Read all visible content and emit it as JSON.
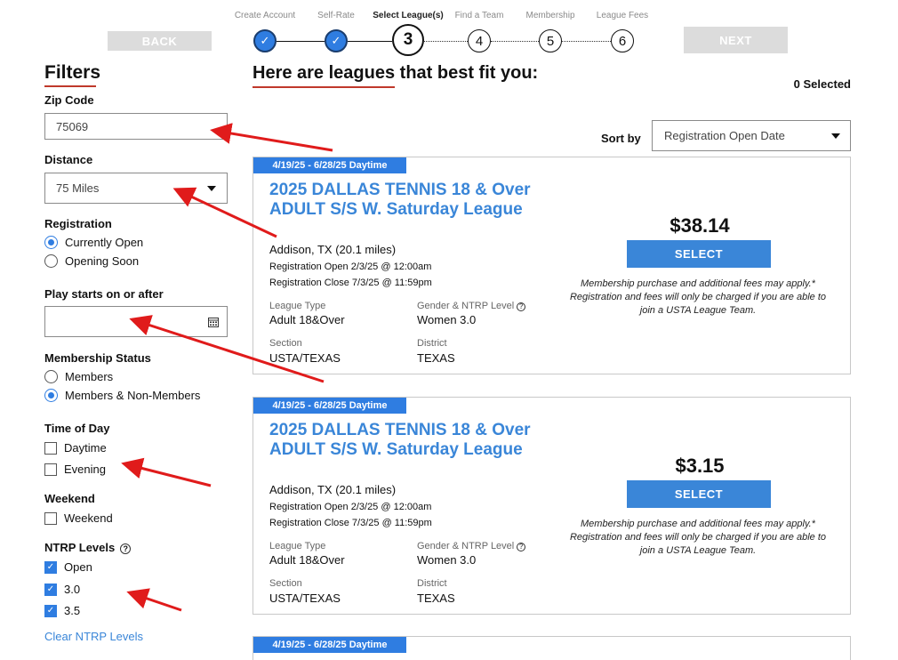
{
  "stepper": {
    "steps": [
      {
        "label": "Create Account",
        "number": "",
        "state": "done"
      },
      {
        "label": "Self-Rate",
        "number": "",
        "state": "done"
      },
      {
        "label": "Select League(s)",
        "number": "3",
        "state": "current"
      },
      {
        "label": "Find a Team",
        "number": "4",
        "state": "todo"
      },
      {
        "label": "Membership",
        "number": "5",
        "state": "todo"
      },
      {
        "label": "League Fees",
        "number": "6",
        "state": "todo"
      }
    ],
    "check_glyph": "✓",
    "back_label": "BACK",
    "next_label": "NEXT"
  },
  "filters": {
    "title": "Filters",
    "zip": {
      "label": "Zip Code",
      "value": "75069"
    },
    "distance": {
      "label": "Distance",
      "value": "75 Miles"
    },
    "registration": {
      "label": "Registration",
      "options": [
        {
          "label": "Currently Open",
          "selected": true
        },
        {
          "label": "Opening Soon",
          "selected": false
        }
      ]
    },
    "play_starts": {
      "label": "Play starts on or after",
      "value": ""
    },
    "membership": {
      "label": "Membership Status",
      "options": [
        {
          "label": "Members",
          "selected": false
        },
        {
          "label": "Members & Non-Members",
          "selected": true
        }
      ]
    },
    "time_of_day": {
      "label": "Time of Day",
      "options": [
        {
          "label": "Daytime",
          "checked": false
        },
        {
          "label": "Evening",
          "checked": false
        }
      ]
    },
    "weekend": {
      "label": "Weekend",
      "options": [
        {
          "label": "Weekend",
          "checked": false
        }
      ]
    },
    "ntrp": {
      "label": "NTRP Levels",
      "help": "?",
      "options": [
        {
          "label": "Open",
          "checked": true
        },
        {
          "label": "3.0",
          "checked": true
        },
        {
          "label": "3.5",
          "checked": true
        }
      ]
    },
    "clear_label": "Clear NTRP Levels"
  },
  "main": {
    "title": "Here are leagues that best fit you:",
    "selected_count": "0 Selected",
    "sort_label": "Sort by",
    "sort_value": "Registration Open Date"
  },
  "cards": [
    {
      "tag": "4/19/25 - 6/28/25 Daytime",
      "title": "2025 DALLAS TENNIS 18 & Over ADULT S/S W. Saturday League",
      "location": "Addison, TX (20.1 miles)",
      "reg_open": "Registration Open 2/3/25 @ 12:00am",
      "reg_close": "Registration Close 7/3/25 @ 11:59pm",
      "league_type_label": "League Type",
      "league_type": "Adult 18&Over",
      "gender_label": "Gender & NTRP Level",
      "gender": "Women 3.0",
      "section_label": "Section",
      "section": "USTA/TEXAS",
      "district_label": "District",
      "district": "TEXAS",
      "price": "$38.14",
      "select_label": "SELECT",
      "note": "Membership purchase and additional fees may apply.* Registration and fees will only be charged if you are able to join a USTA League Team."
    },
    {
      "tag": "4/19/25 - 6/28/25 Daytime",
      "title": "2025 DALLAS TENNIS 18 & Over ADULT S/S W. Saturday League",
      "location": "Addison, TX (20.1 miles)",
      "reg_open": "Registration Open 2/3/25 @ 12:00am",
      "reg_close": "Registration Close 7/3/25 @ 11:59pm",
      "league_type_label": "League Type",
      "league_type": "Adult 18&Over",
      "gender_label": "Gender & NTRP Level",
      "gender": "Women 3.0",
      "section_label": "Section",
      "section": "USTA/TEXAS",
      "district_label": "District",
      "district": "TEXAS",
      "price": "$3.15",
      "select_label": "SELECT",
      "note": "Membership purchase and additional fees may apply.* Registration and fees will only be charged if you are able to join a USTA League Team."
    },
    {
      "tag": "4/19/25 - 6/28/25 Daytime"
    }
  ],
  "colors": {
    "accent": "#2f7de1",
    "link": "#3a86d8",
    "annotation": "#e01b1b"
  }
}
